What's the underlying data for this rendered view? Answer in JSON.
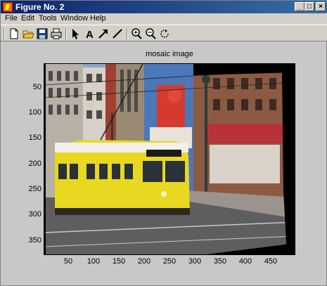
{
  "window": {
    "title": "Figure No. 2",
    "minimize": "_",
    "maximize": "□",
    "close": "×"
  },
  "menu": [
    "File",
    "Edit",
    "Tools",
    "Window",
    "Help"
  ],
  "toolbar_icons": [
    "new-file-icon",
    "open-folder-icon",
    "save-icon",
    "print-icon",
    "arrow-select-icon",
    "text-tool-icon",
    "arrow-tool-icon",
    "line-tool-icon",
    "zoom-in-icon",
    "zoom-out-icon",
    "rotate-icon"
  ],
  "plot": {
    "title": "mosaic image",
    "y_ticks": [
      "50",
      "100",
      "150",
      "200",
      "250",
      "300",
      "350"
    ],
    "x_ticks": [
      "50",
      "100",
      "150",
      "200",
      "250",
      "300",
      "350",
      "400",
      "450"
    ]
  },
  "image": {
    "content": "stitched photo of yellow streetcar on city street"
  }
}
